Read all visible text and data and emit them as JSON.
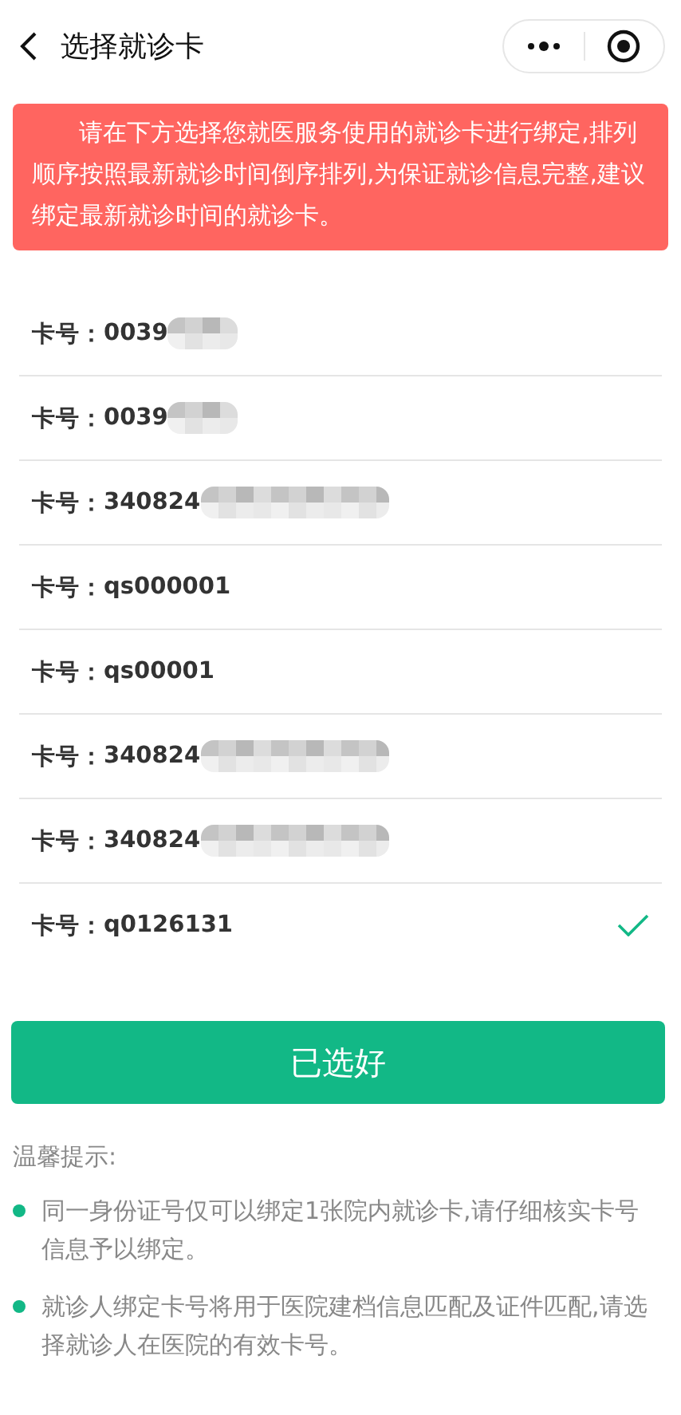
{
  "header": {
    "title": "选择就诊卡"
  },
  "notice": "请在下方选择您就医服务使用的就诊卡进行绑定,排列顺序按照最新就诊时间倒序排列,为保证就诊信息完整,建议绑定最新就诊时间的就诊卡。",
  "cards": [
    {
      "kind": "short_masked",
      "label": "卡号：",
      "number": "0039",
      "selected": false
    },
    {
      "kind": "short_masked",
      "label": "卡号：",
      "number": "0039",
      "selected": false
    },
    {
      "kind": "long_masked",
      "label": "卡号：",
      "number": "340824",
      "selected": false
    },
    {
      "kind": "plain",
      "label": "卡号：",
      "number": "qs000001",
      "selected": false
    },
    {
      "kind": "plain",
      "label": "卡号：",
      "number": "qs00001",
      "selected": false
    },
    {
      "kind": "long_masked",
      "label": "卡号：",
      "number": "340824",
      "selected": false
    },
    {
      "kind": "long_masked",
      "label": "卡号：",
      "number": "340824",
      "selected": false
    },
    {
      "kind": "plain",
      "label": "卡号：",
      "number": "q0126131",
      "selected": true
    }
  ],
  "confirm_button": "已选好",
  "tips": {
    "title": "温馨提示:",
    "items": [
      "同一身份证号仅可以绑定1张院内就诊卡,请仔细核实卡号信息予以绑定。",
      "就诊人绑定卡号将用于医院建档信息匹配及证件匹配,请选择就诊人在医院的有效卡号。"
    ]
  }
}
